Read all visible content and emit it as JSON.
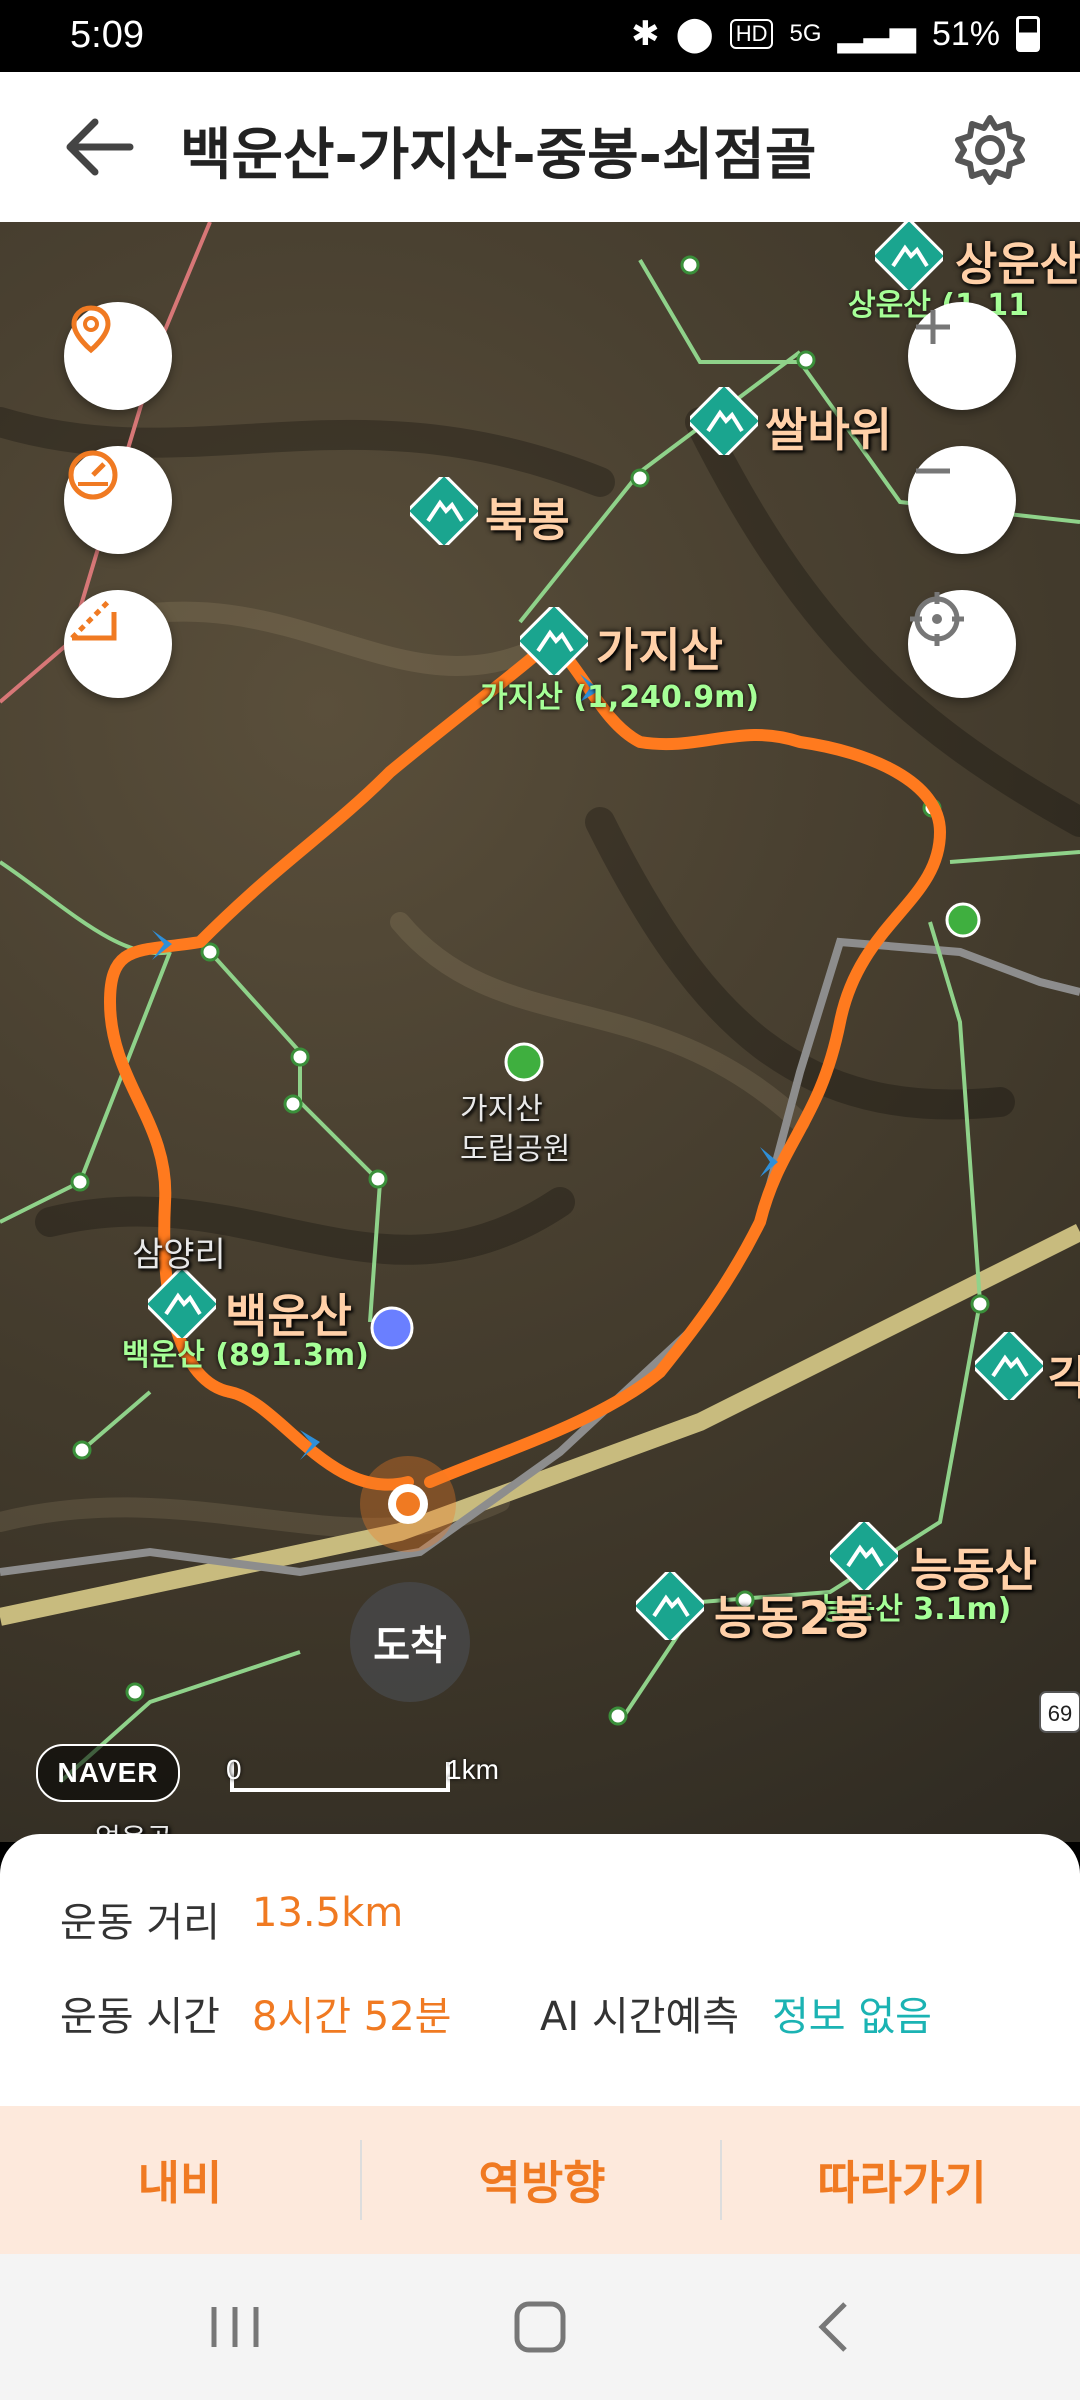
{
  "status_bar": {
    "time": "5:09",
    "battery": "51%",
    "hd_voice": "HD",
    "network": "5G"
  },
  "header": {
    "title": "백운산-가지산-중봉-쇠점골"
  },
  "map": {
    "peaks": [
      {
        "name": "상운산",
        "elev": "상운산 (1,11"
      },
      {
        "name": "쌀바위"
      },
      {
        "name": "북봉"
      },
      {
        "name": "가지산",
        "elev": "가지산 (1,240.9m)"
      },
      {
        "name": "백운산",
        "elev": "백운산 (891.3m)"
      },
      {
        "name": "능동산",
        "elev": "능동산 3.1m)"
      },
      {
        "name": "능동2봉"
      },
      {
        "name": "각"
      }
    ],
    "park_name_line1": "가지산",
    "park_name_line2": "도립공원",
    "village": "삼양리",
    "arrival_label": "도착",
    "scale_start": "0",
    "scale_end": "1km",
    "brand": "NAVER",
    "road_number": "69",
    "partial_label": "얼음골"
  },
  "info": {
    "distance_label": "운동 거리",
    "distance_value": "13.5km",
    "time_label": "운동 시간",
    "time_value": "8시간 52분",
    "ai_label": "AI 시간예측",
    "ai_value": "정보 없음"
  },
  "actions": {
    "navi": "내비",
    "reverse": "역방향",
    "follow": "따라가기"
  },
  "colors": {
    "accent": "#f07a22",
    "teal": "#1bb3b3",
    "route": "#ff7a1e",
    "peak_icon": "#1aa58f"
  }
}
